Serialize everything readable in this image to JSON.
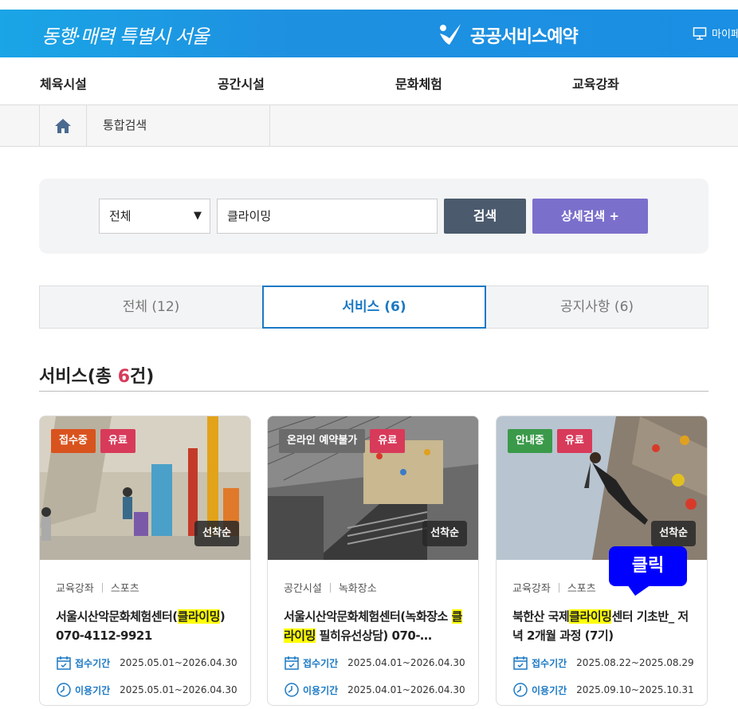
{
  "header": {
    "slogan": "동행·매력 특별시 서울",
    "logo_text": "공공서비스예약",
    "mypage_label": "마이페"
  },
  "gnb": {
    "items": [
      {
        "label": "체육시설"
      },
      {
        "label": "공간시설"
      },
      {
        "label": "문화체험"
      },
      {
        "label": "교육강좌"
      }
    ]
  },
  "breadcrumb": {
    "current": "통합검색"
  },
  "search": {
    "scope_value": "전체",
    "keyword_value": "클라이밍",
    "search_label": "검색",
    "advanced_label": "상세검색 +"
  },
  "tabs": [
    {
      "label": "전체 (12)",
      "active": false
    },
    {
      "label": "서비스 (6)",
      "active": true
    },
    {
      "label": "공지사항 (6)",
      "active": false
    }
  ],
  "section": {
    "title_prefix": "서비스(총 ",
    "count": "6",
    "title_suffix": "건)"
  },
  "cards": [
    {
      "badges": [
        {
          "label": "접수중",
          "color": "#d9531e"
        },
        {
          "label": "유료",
          "color": "#d83a5a"
        }
      ],
      "order_label": "선착순",
      "category": "교육강좌",
      "subcategory": "스포츠",
      "title_before": "서울시산악문화체험센터(",
      "title_highlight": "클라이밍",
      "title_after": ") 070-4112-9921",
      "receipt_label": "접수기간",
      "receipt_period": "2025.05.01~2026.04.30",
      "use_label": "이용기간",
      "use_period": "2025.05.01~2026.04.30"
    },
    {
      "badges": [
        {
          "label": "온라인 예약불가",
          "color": "#6b6b6b"
        },
        {
          "label": "유료",
          "color": "#d83a5a"
        }
      ],
      "order_label": "선착순",
      "category": "공간시설",
      "subcategory": "녹화장소",
      "title_before": "서울시산악문화체험센터(녹화장소 ",
      "title_highlight": "클라이밍",
      "title_after": " 필히유선상담) 070-…",
      "receipt_label": "접수기간",
      "receipt_period": "2025.04.01~2026.04.30",
      "use_label": "이용기간",
      "use_period": "2025.04.01~2026.04.30"
    },
    {
      "badges": [
        {
          "label": "안내중",
          "color": "#3a9a4a"
        },
        {
          "label": "유료",
          "color": "#d83a5a"
        }
      ],
      "order_label": "선착순",
      "category": "교육강좌",
      "subcategory": "스포츠",
      "title_before": "북한산 국제",
      "title_highlight": "클라이밍",
      "title_after": "센터 기초반_ 저녁 2개월 과정 (7기)",
      "receipt_label": "접수기간",
      "receipt_period": "2025.08.22~2025.08.29",
      "use_label": "이용기간",
      "use_period": "2025.09.10~2025.10.31"
    }
  ],
  "callout": {
    "label": "클릭"
  },
  "colors": {
    "topbar": "#1aa5e6",
    "accent_blue": "#1b79c4",
    "search_button": "#4b5a6d",
    "advanced_button": "#7b6fcc",
    "count_red": "#d83a5a",
    "highlight": "#ffff00",
    "callout": "#0000ff"
  }
}
